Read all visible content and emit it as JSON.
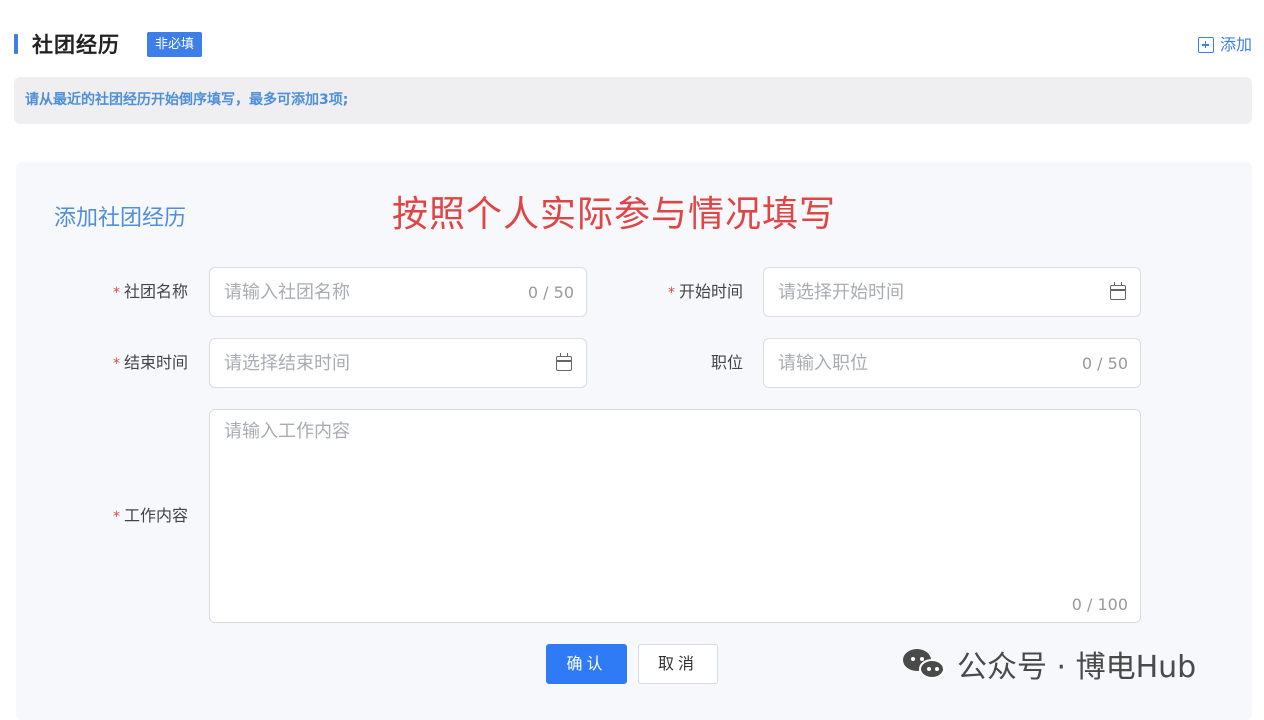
{
  "section": {
    "title": "社团经历",
    "badge": "非必填",
    "add_label": "添加",
    "notice": "请从最近的社团经历开始倒序填写，最多可添加3项;"
  },
  "form": {
    "title": "添加社团经历",
    "annotation": "按照个人实际参与情况填写",
    "required_mark": "*",
    "fields": {
      "club_name": {
        "label": "社团名称",
        "placeholder": "请输入社团名称",
        "counter": "0 / 50"
      },
      "start_time": {
        "label": "开始时间",
        "placeholder": "请选择开始时间"
      },
      "end_time": {
        "label": "结束时间",
        "placeholder": "请选择结束时间"
      },
      "position": {
        "label": "职位",
        "placeholder": "请输入职位",
        "counter": "0 / 50"
      },
      "work_content": {
        "label": "工作内容",
        "placeholder": "请输入工作内容",
        "counter": "0 / 100"
      }
    },
    "confirm_label": "确认",
    "cancel_label": "取消"
  },
  "watermark": {
    "text": "公众号 · 博电Hub"
  },
  "colors": {
    "accent": "#3d7ee8",
    "primary_button": "#2f7bf5",
    "required": "#e04545",
    "annotation": "#e04545"
  }
}
